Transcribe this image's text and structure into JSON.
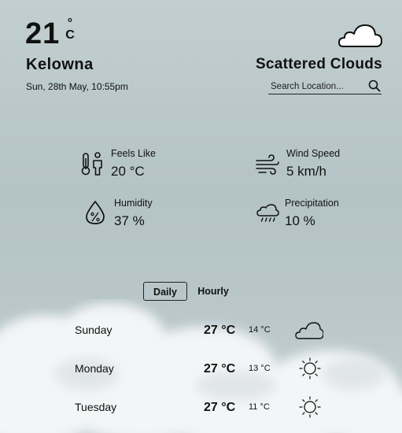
{
  "current": {
    "temperature": "21",
    "unit_degree": "°",
    "unit_letter": "C",
    "city": "Kelowna",
    "datetime": "Sun, 28th May, 10:55pm",
    "condition": "Scattered Clouds",
    "condition_icon": "cloud-icon"
  },
  "search": {
    "placeholder": "Search Location..."
  },
  "stats": {
    "feels_like": {
      "label": "Feels Like",
      "value": "20 °C",
      "icon": "thermometer-person-icon"
    },
    "wind_speed": {
      "label": "Wind Speed",
      "value": "5 km/h",
      "icon": "wind-icon"
    },
    "humidity": {
      "label": "Humidity",
      "value": "37 %",
      "icon": "humidity-drop-icon"
    },
    "precipitation": {
      "label": "Precipitation",
      "value": "10 %",
      "icon": "rain-cloud-icon"
    }
  },
  "tabs": {
    "daily": "Daily",
    "hourly": "Hourly",
    "active": "Daily"
  },
  "forecast": [
    {
      "day": "Sunday",
      "high": "27 °C",
      "low": "14 °C",
      "icon": "cloud-icon"
    },
    {
      "day": "Monday",
      "high": "27 °C",
      "low": "13 °C",
      "icon": "sun-icon"
    },
    {
      "day": "Tuesday",
      "high": "27 °C",
      "low": "11 °C",
      "icon": "sun-icon"
    }
  ]
}
